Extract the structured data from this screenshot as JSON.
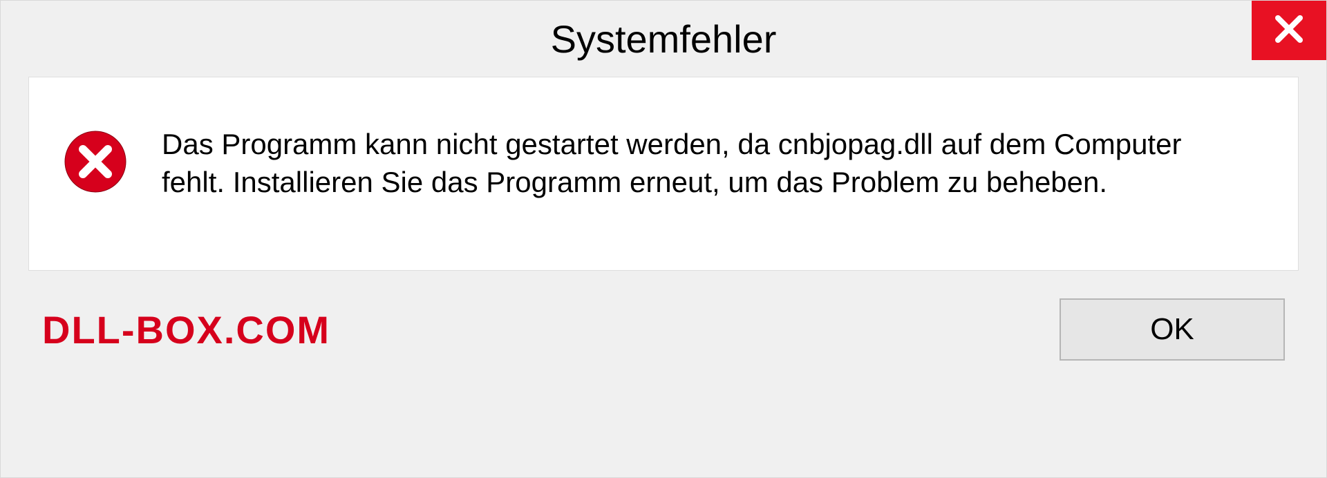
{
  "dialog": {
    "title": "Systemfehler",
    "message": "Das Programm kann nicht gestartet werden, da cnbjopag.dll auf dem Computer fehlt. Installieren Sie das Programm erneut, um das Problem zu beheben.",
    "ok_label": "OK"
  },
  "watermark": "DLL-BOX.COM",
  "icons": {
    "close": "close-icon",
    "error": "error-circle-x-icon"
  },
  "colors": {
    "close_bg": "#e81123",
    "error_icon": "#d6001c",
    "watermark": "#d6001c"
  }
}
